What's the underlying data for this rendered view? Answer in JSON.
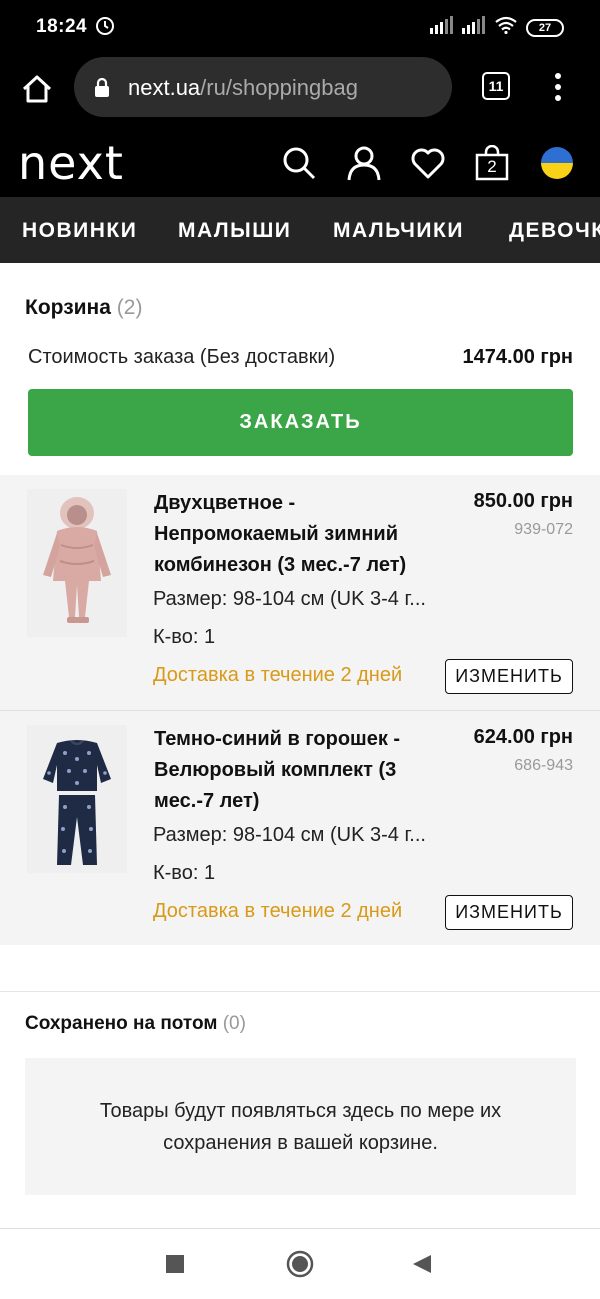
{
  "status_bar": {
    "time": "18:24",
    "battery": "27"
  },
  "browser": {
    "url_domain": "next.ua",
    "url_path": "/ru/shoppingbag",
    "tab_count": "11"
  },
  "header": {
    "logo": "next",
    "bag_count": "2"
  },
  "nav": {
    "items": [
      "НОВИНКИ",
      "МАЛЫШИ",
      "МАЛЬЧИКИ",
      "ДЕВОЧКИ"
    ]
  },
  "cart": {
    "title": "Корзина",
    "count": "(2)",
    "summary_label": "Стоимость заказа (Без доставки)",
    "summary_value": "1474.00 грн",
    "order_button": "ЗАКАЗАТЬ"
  },
  "items": [
    {
      "title": "Двухцветное - Непромокаемый зимний комбинезон (3 мес.-7 лет)",
      "price": "850.00 грн",
      "code": "939-072",
      "size": "Размер: 98-104 см (UK 3-4 г...",
      "qty": "К-во: 1",
      "delivery": "Доставка в течение 2 дней",
      "change_label": "ИЗМЕНИТЬ"
    },
    {
      "title": "Темно-синий в горошек - Велюровый комплект (3 мес.-7 лет)",
      "price": "624.00 грн",
      "code": "686-943",
      "size": "Размер: 98-104 см (UK 3-4 г...",
      "qty": "К-во: 1",
      "delivery": "Доставка в течение 2 дней",
      "change_label": "ИЗМЕНИТЬ"
    }
  ],
  "saved": {
    "title": "Сохранено на потом",
    "count": "(0)",
    "empty_message": "Товары будут появляться здесь по мере их сохранения в вашей корзине."
  },
  "colors": {
    "accent_green": "#3aa647",
    "delivery_orange": "#d89a18",
    "header_black": "#000000",
    "nav_dark": "#252525"
  }
}
